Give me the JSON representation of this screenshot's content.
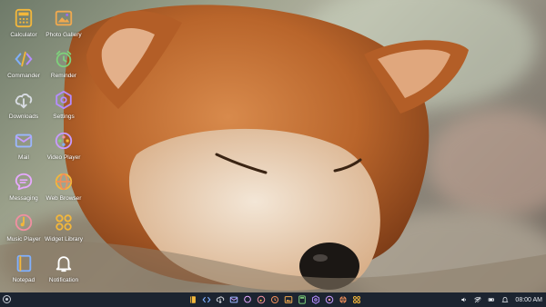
{
  "desktop": {
    "icons": [
      {
        "label": "Calculator",
        "icon": "calculator-icon"
      },
      {
        "label": "Photo Gallery",
        "icon": "photo-gallery-icon"
      },
      {
        "label": "Commander",
        "icon": "commander-icon"
      },
      {
        "label": "Reminder",
        "icon": "reminder-icon"
      },
      {
        "label": "Downloads",
        "icon": "downloads-icon"
      },
      {
        "label": "Settings",
        "icon": "settings-icon"
      },
      {
        "label": "Mail",
        "icon": "mail-icon"
      },
      {
        "label": "Video Player",
        "icon": "video-player-icon"
      },
      {
        "label": "Messaging",
        "icon": "messaging-icon"
      },
      {
        "label": "Web Browser",
        "icon": "web-browser-icon"
      },
      {
        "label": "Music Player",
        "icon": "music-player-icon"
      },
      {
        "label": "Widget Library",
        "icon": "widget-library-icon"
      },
      {
        "label": "Notepad",
        "icon": "notepad-icon"
      },
      {
        "label": "Notification",
        "icon": "notification-icon"
      }
    ]
  },
  "taskbar": {
    "start_icon": "start-menu-icon",
    "dock_icons": [
      "notepad-icon",
      "commander-icon",
      "downloads-icon",
      "mail-icon",
      "messaging-icon",
      "music-player-icon",
      "reminder-icon",
      "photo-gallery-icon",
      "calculator-icon",
      "settings-icon",
      "video-player-icon",
      "web-browser-icon",
      "widget-library-icon"
    ],
    "tray": {
      "icons": [
        "volume-icon",
        "wifi-icon",
        "battery-icon",
        "notification-icon"
      ],
      "clock": "08:00 AM"
    }
  },
  "colors": {
    "taskbar_bg": "#1c2430",
    "icon_gradient_start": "#f3b73b",
    "icon_gradient_end": "#9b6cf0"
  }
}
